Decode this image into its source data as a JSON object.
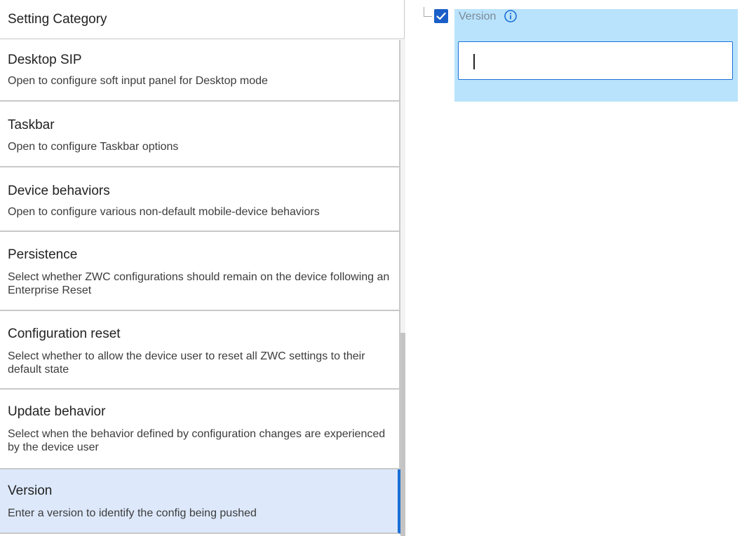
{
  "left_panel": {
    "header": "Setting Category",
    "items": [
      {
        "title": "Desktop SIP",
        "description": "Open to configure soft input panel for Desktop mode",
        "selected": false
      },
      {
        "title": "Taskbar",
        "description": "Open to configure Taskbar options",
        "selected": false
      },
      {
        "title": "Device behaviors",
        "description": "Open to configure various non-default mobile-device behaviors",
        "selected": false
      },
      {
        "title": "Persistence",
        "description": "Select whether ZWC configurations should remain on the device following an Enterprise Reset",
        "selected": false
      },
      {
        "title": "Configuration reset",
        "description": "Select whether to allow the device user to reset all ZWC settings to their default state",
        "selected": false
      },
      {
        "title": "Update behavior",
        "description": "Select when the behavior defined by configuration changes are experienced by the device user",
        "selected": false
      },
      {
        "title": "Version",
        "description": "Enter a version to identify the config being pushed",
        "selected": true
      }
    ]
  },
  "right_panel": {
    "setting_label": "Version",
    "checkbox_checked": true,
    "input_value": "",
    "info_icon": "info-icon"
  },
  "colors": {
    "selected_bg": "#dde9fb",
    "selected_accent": "#1a6fd6",
    "setting_highlight": "#b9e3fc",
    "checkbox": "#1a5fc8"
  }
}
